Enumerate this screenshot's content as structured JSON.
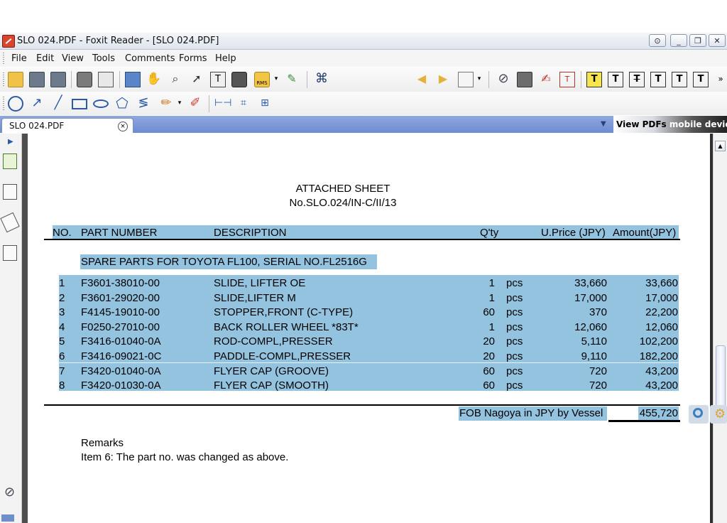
{
  "window": {
    "title": "SLO 024.PDF - Foxit Reader - [SLO 024.PDF]",
    "controls": {
      "restore_icon": "restore-icon",
      "minimize": "_",
      "maximize": "❐",
      "close": "✕"
    }
  },
  "menu": [
    "File",
    "Edit",
    "View",
    "Tools",
    "Comments",
    "Forms",
    "Help"
  ],
  "toolbar": {
    "search_placeholder": "",
    "overflow": "»"
  },
  "tabs": {
    "active_label": "SLO 024.PDF",
    "close": "×",
    "promo_a": "View PDFs",
    "promo_b": " mobile devices"
  },
  "document": {
    "title": "ATTACHED SHEET",
    "ref": "No.SLO.024/IN-C/II/13",
    "columns": {
      "no": "NO.",
      "part": "PART NUMBER",
      "desc": "DESCRIPTION",
      "qty": "Q'ty",
      "price": "U.Price (JPY)",
      "amount": "Amount(JPY)"
    },
    "section": "SPARE PARTS FOR TOYOTA FL100, SERIAL NO.FL2516G",
    "rows": [
      {
        "no": "1",
        "part": "F3601-38010-00",
        "desc": "SLIDE, LIFTER OE",
        "qty": "1",
        "unit": "pcs",
        "price": "33,660",
        "amount": "33,660"
      },
      {
        "no": "2",
        "part": "F3601-29020-00",
        "desc": "SLIDE,LIFTER M",
        "qty": "1",
        "unit": "pcs",
        "price": "17,000",
        "amount": "17,000"
      },
      {
        "no": "3",
        "part": "F4145-19010-00",
        "desc": "STOPPER,FRONT (C-TYPE)",
        "qty": "60",
        "unit": "pcs",
        "price": "370",
        "amount": "22,200"
      },
      {
        "no": "4",
        "part": "F0250-27010-00",
        "desc": "BACK ROLLER WHEEL *83T*",
        "qty": "1",
        "unit": "pcs",
        "price": "12,060",
        "amount": "12,060"
      },
      {
        "no": "5",
        "part": "F3416-01040-0A",
        "desc": "ROD-COMPL,PRESSER",
        "qty": "20",
        "unit": "pcs",
        "price": "5,110",
        "amount": "102,200"
      },
      {
        "no": "6",
        "part": "F3416-09021-0C",
        "desc": "PADDLE-COMPL,PRESSER",
        "qty": "20",
        "unit": "pcs",
        "price": "9,110",
        "amount": "182,200"
      },
      {
        "no": "7",
        "part": "F3420-01040-0A",
        "desc": "FLYER CAP (GROOVE)",
        "qty": "60",
        "unit": "pcs",
        "price": "720",
        "amount": "43,200"
      },
      {
        "no": "8",
        "part": "F3420-01030-0A",
        "desc": "FLYER CAP (SMOOTH)",
        "qty": "60",
        "unit": "pcs",
        "price": "720",
        "amount": "43,200"
      }
    ],
    "total_label": "FOB Nagoya in JPY by Vessel",
    "total_value": "455,720",
    "remarks_title": "Remarks",
    "remarks_text": "Item 6: The part no. was changed as above."
  },
  "colors": {
    "highlight": "#94c3e0",
    "tabstrip": "#7b96d6",
    "frame": "#4e4e4e"
  }
}
